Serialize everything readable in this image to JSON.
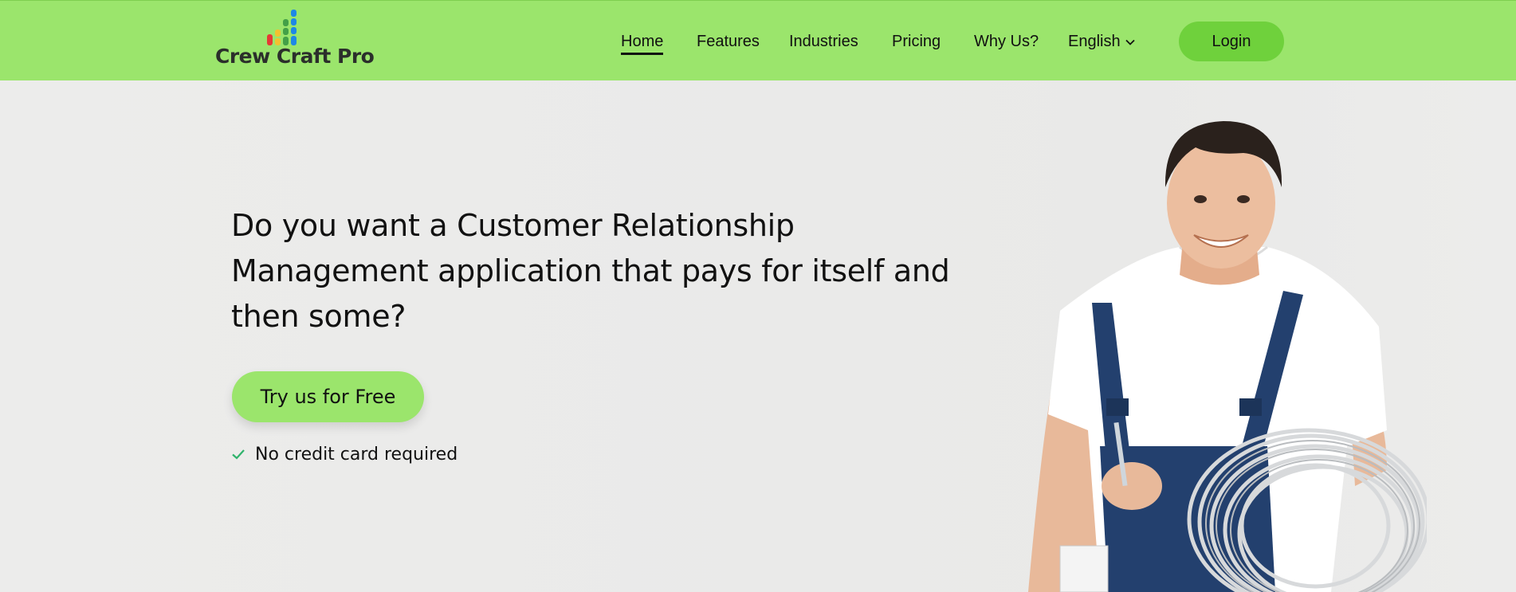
{
  "brand": {
    "name": "Crew Craft Pro",
    "bar_colors": [
      "#e53935",
      "#f2c230",
      "#43a047",
      "#1e88e5"
    ]
  },
  "nav": {
    "items": [
      {
        "label": "Home",
        "active": true
      },
      {
        "label": "Features",
        "active": false
      },
      {
        "label": "Industries",
        "active": false
      },
      {
        "label": "Pricing",
        "active": false
      },
      {
        "label": "Why Us?",
        "active": false
      }
    ],
    "language": "English",
    "login_label": "Login"
  },
  "hero": {
    "headline": "Do you want a Customer Relationship Management application that pays for itself and then some?",
    "cta_label": "Try us for Free",
    "note": "No credit card required",
    "image_alt": "smiling-technician-with-cable-coil"
  },
  "colors": {
    "navbar": "#9be56c",
    "login_button": "#6fd13c",
    "cta_button": "#9be56c",
    "check": "#2fb36b"
  }
}
